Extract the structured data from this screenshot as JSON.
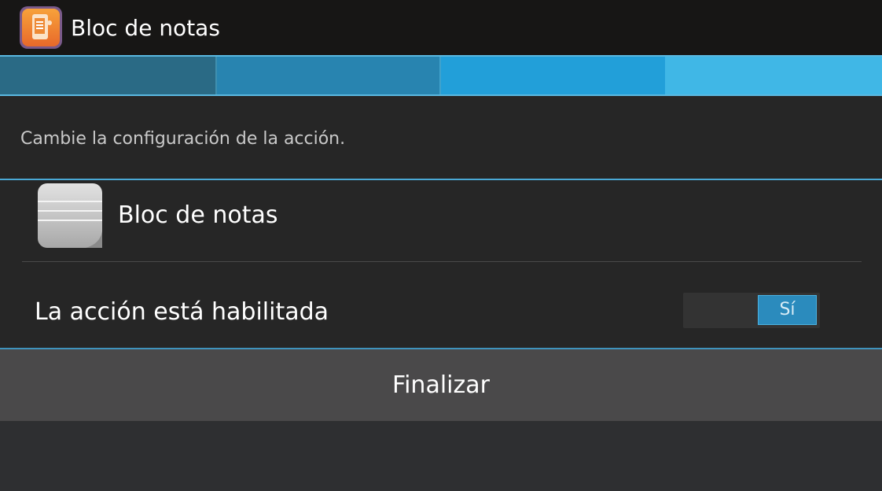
{
  "action_bar": {
    "title": "Bloc de notas",
    "icon": "notepad-app-icon"
  },
  "steps": {
    "count": 4,
    "current": 4
  },
  "description": "Cambie la configuración de la acción.",
  "app_row": {
    "label": "Bloc de notas",
    "icon": "notes-icon"
  },
  "enabled_row": {
    "label": "La acción está habilitada",
    "toggle_value": "Sí",
    "toggle_on": true
  },
  "footer": {
    "finish_label": "Finalizar"
  },
  "colors": {
    "accent": "#33b5e5",
    "toggle_on": "#2b8bbd",
    "action_bar": "#171615",
    "button": "#4a494a"
  }
}
